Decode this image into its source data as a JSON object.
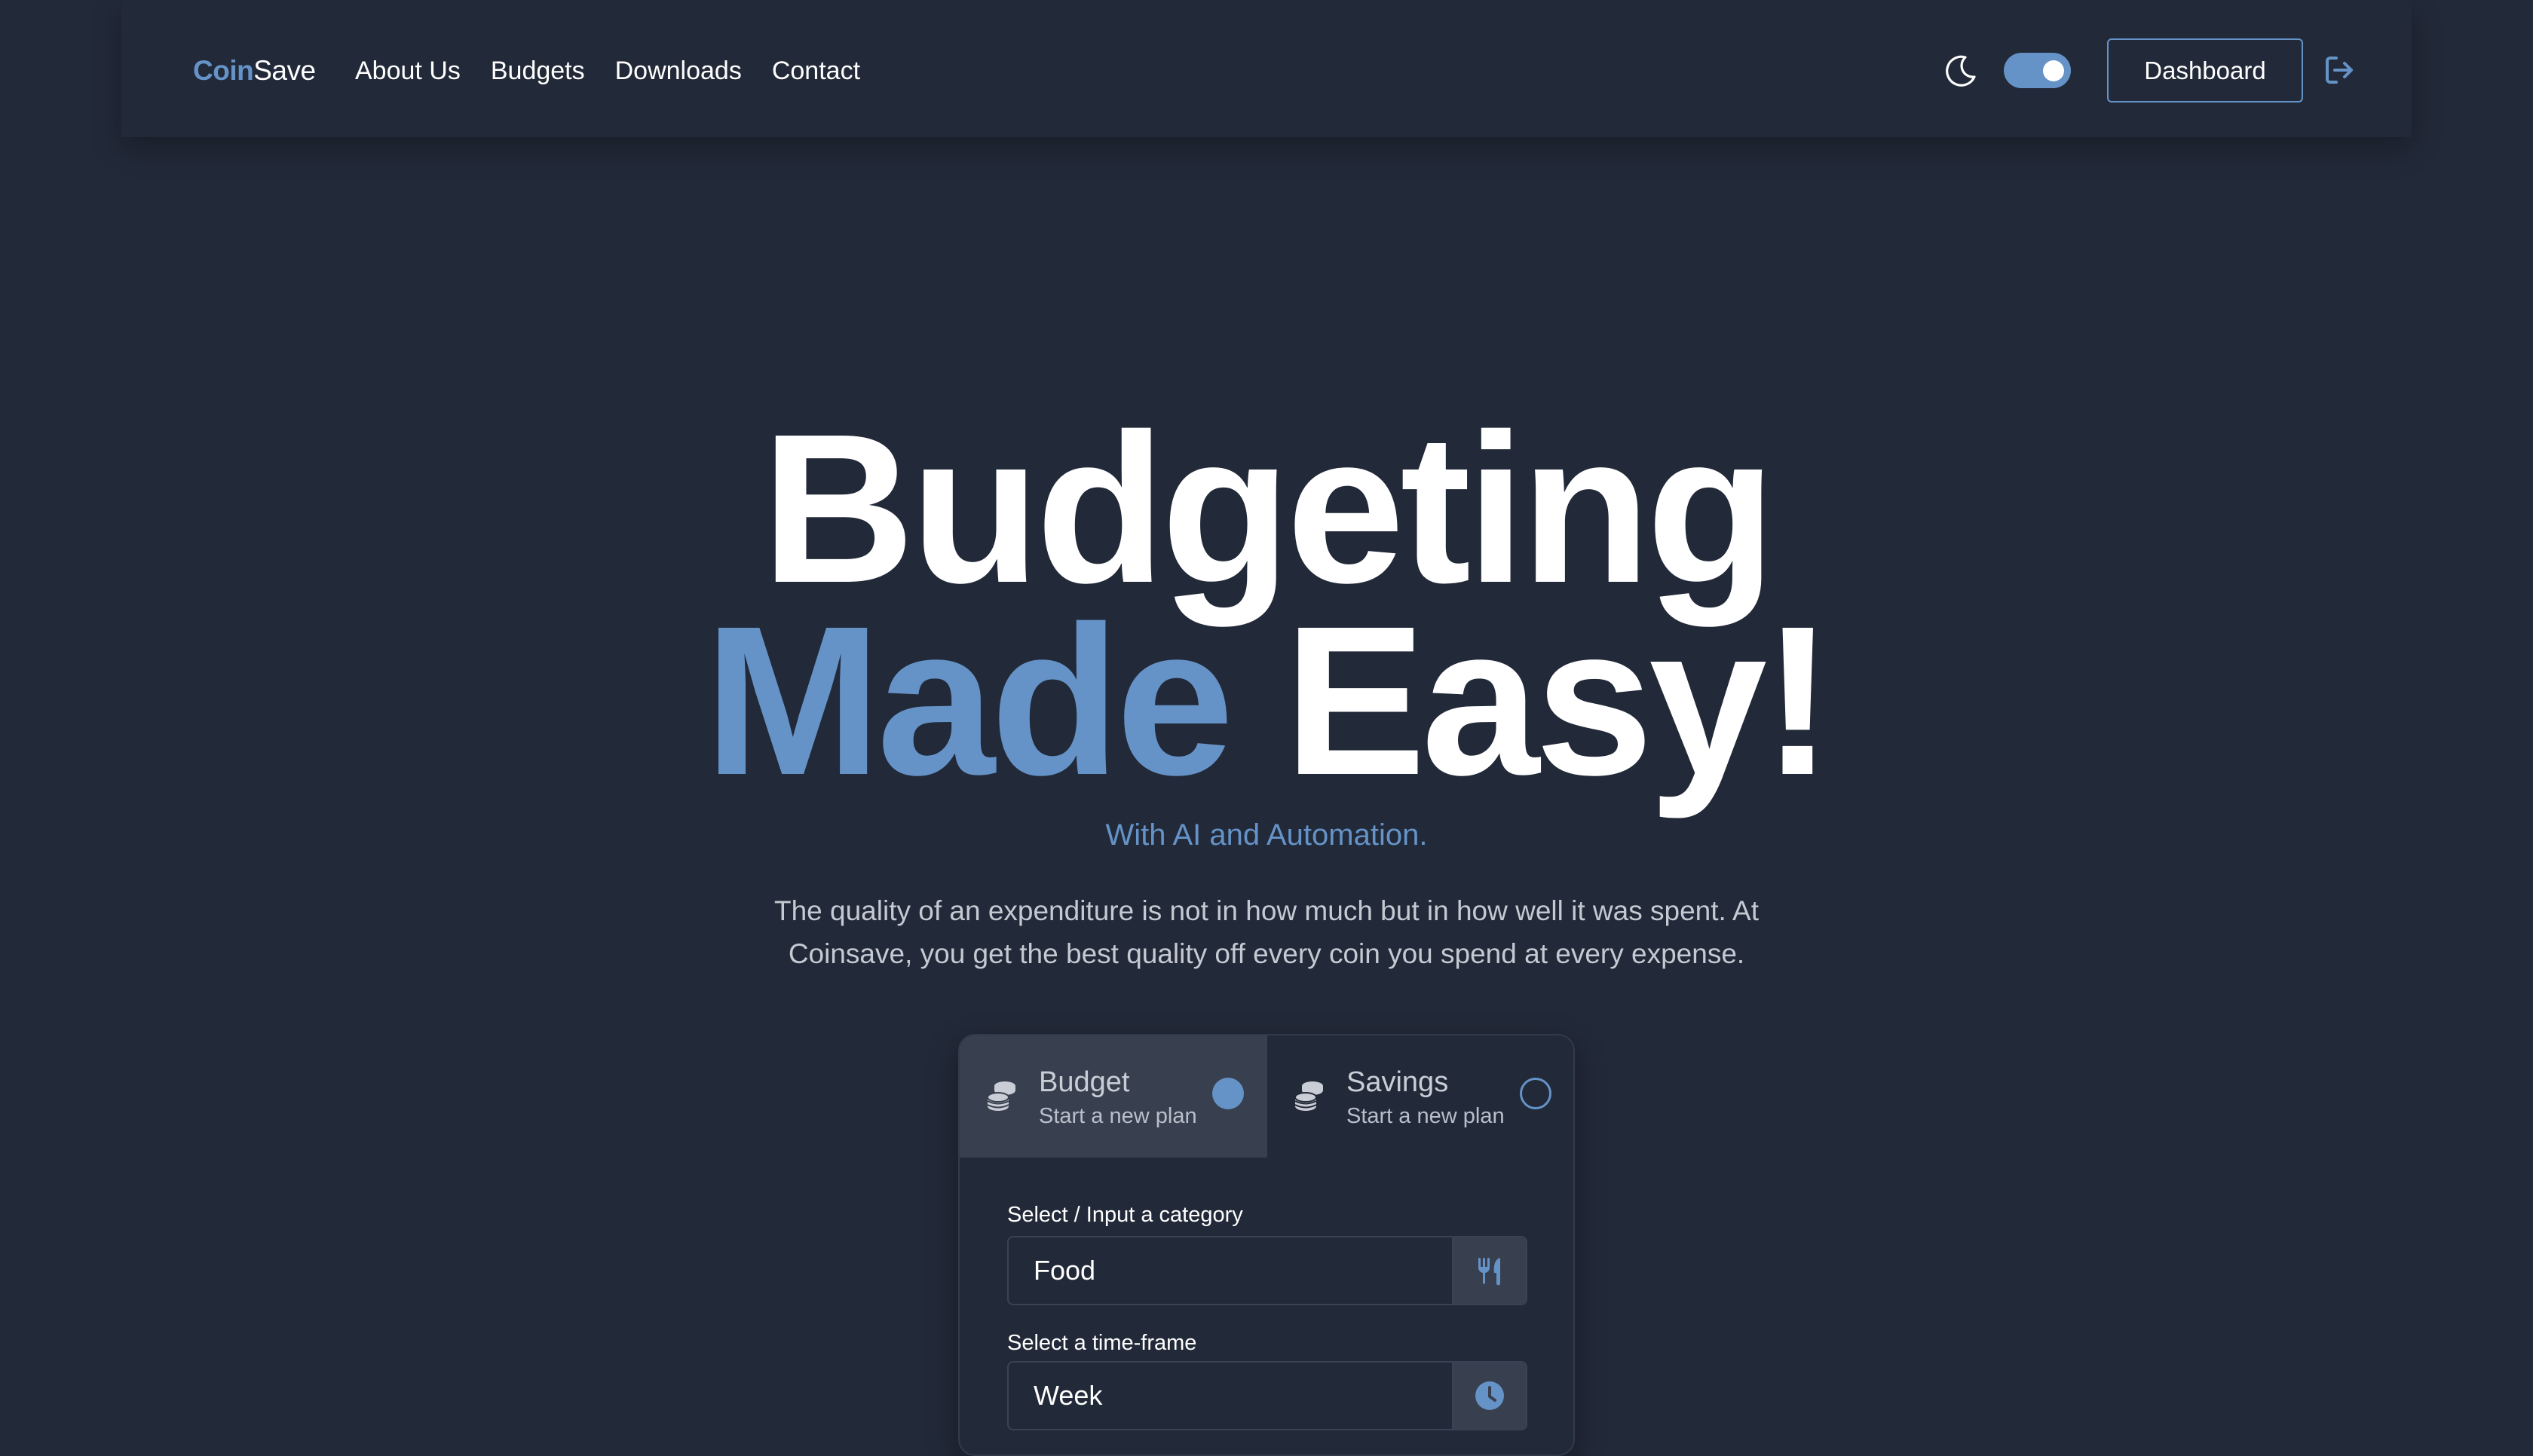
{
  "navbar": {
    "brand_part1": "Coin",
    "brand_part2": "Save",
    "links": [
      "About Us",
      "Budgets",
      "Downloads",
      "Contact"
    ],
    "theme_icon": "moon-icon",
    "theme_toggle_on": true,
    "dashboard_label": "Dashboard",
    "logout_icon": "logout-icon"
  },
  "hero": {
    "line1": "Budgeting",
    "line2_accent": "Made",
    "line2_rest": "Easy!",
    "tagline": "With AI and Automation.",
    "description": "The quality of an expenditure is not in how much but in how well it was spent. At Coinsave, you get the best quality off every coin you spend at every expense."
  },
  "plan_card": {
    "tabs": [
      {
        "title": "Budget",
        "subtitle": "Start a new plan",
        "icon": "coins-icon",
        "selected": true
      },
      {
        "title": "Savings",
        "subtitle": "Start a new plan",
        "icon": "coins-icon",
        "selected": false
      }
    ],
    "category": {
      "label": "Select / Input a category",
      "value": "Food",
      "icon": "utensils-icon"
    },
    "timeframe": {
      "label": "Select a time-frame",
      "value": "Week",
      "icon": "clock-icon"
    }
  },
  "colors": {
    "background": "#222938",
    "accent": "#6593c7",
    "panel": "#38404f",
    "muted_text": "#c4c9d2"
  }
}
